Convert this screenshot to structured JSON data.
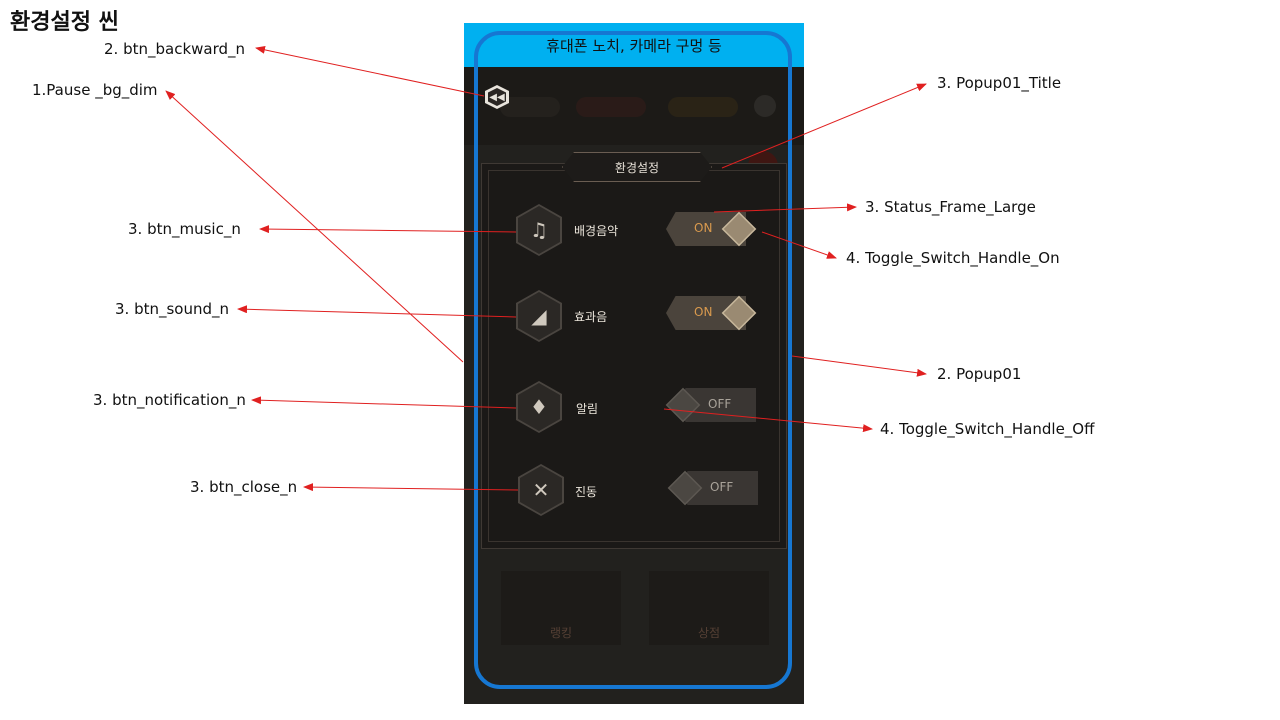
{
  "scene_title": "환경설정 씬",
  "device_notch_label": "휴대폰 노치, 카메라 구멍 등",
  "popup": {
    "title": "환경설정",
    "options": [
      {
        "label": "배경음악",
        "icon": "music-note-icon",
        "state": "ON"
      },
      {
        "label": "효과음",
        "icon": "speaker-icon",
        "state": "ON"
      },
      {
        "label": "알림",
        "icon": "bell-icon",
        "state": "OFF"
      },
      {
        "label": "진동",
        "icon": "close-x-icon",
        "state": "OFF"
      }
    ]
  },
  "background_cards": [
    {
      "label": "랭킹",
      "icon": "trophy-icon"
    },
    {
      "label": "상점",
      "icon": "chest-icon"
    }
  ],
  "annotations": {
    "pause_bg_dim": "1.Pause _bg_dim",
    "btn_backward": "2. btn_backward_n",
    "popup01": "2. Popup01",
    "popup01_title": "3. Popup01_Title",
    "btn_music": "3. btn_music_n",
    "btn_sound": "3. btn_sound_n",
    "btn_notification": "3. btn_notification_n",
    "btn_close": "3. btn_close_n",
    "status_frame_large": "3. Status_Frame_Large",
    "toggle_on": "4. Toggle_Switch_Handle_On",
    "toggle_off": "4. Toggle_Switch_Handle_Off"
  },
  "colors": {
    "notch": "#00b0f0",
    "frame_outline": "#1677d2",
    "arrow": "#e02020",
    "toggle_on_text": "#d99a4e"
  }
}
